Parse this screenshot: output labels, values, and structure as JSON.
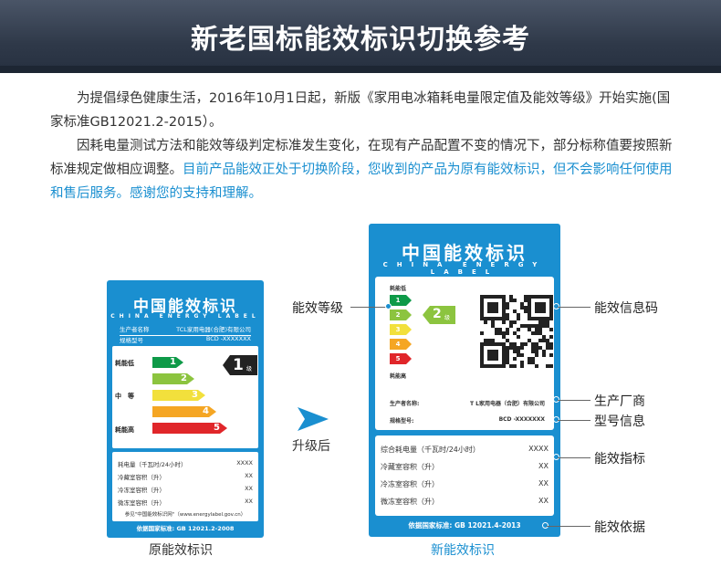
{
  "header": {
    "title": "新老国标能效标识切换参考"
  },
  "intro": {
    "para1": "为提倡绿色健康生活，2016年10月1日起，新版《家用电冰箱耗电量限定值及能效等级》开始实施(国家标准GB12021.2-2015）。",
    "para2_black": "因耗电量测试方法和能效等级判定标准发生变化，在现有产品配置不变的情况下，部分标称值要按照新标准规定做相应调整。",
    "para2_blue": "目前产品能效正处于切换阶段，您收到的产品为原有能效标识，但不会影响任何使用和售后服务。感谢您的支持和理解。"
  },
  "old_label": {
    "title_cn": "中国能效标识",
    "title_en": "CHINA ENERGY LABEL",
    "manufacturer_key": "生产者名称",
    "manufacturer_value": "TCL家用电器(合肥)有限公司",
    "model_key": "规格型号",
    "model_value": "BCD -XXXXXXX",
    "scale_low": "耗能低",
    "scale_mid": "中　等",
    "scale_high": "耗能高",
    "grades": [
      "1",
      "2",
      "3",
      "4",
      "5"
    ],
    "grade_colors": [
      "#0e9a48",
      "#8cc43f",
      "#f2e03c",
      "#f5a623",
      "#e0262a"
    ],
    "current_grade": "1",
    "current_grade_suffix": "级",
    "specs": [
      {
        "label": "耗电量（千瓦时/24小时）",
        "value": "XXXX"
      },
      {
        "label": "冷藏室容积（升）",
        "value": "XX"
      },
      {
        "label": "冷冻室容积（升）",
        "value": "XX"
      },
      {
        "label": "微冻室容积（升）",
        "value": "XX"
      }
    ],
    "reference": "参见\"中国能效标识网\"（www.energylabel.gov.cn）",
    "basis": "依据国家标准: GB 12021.2-2008",
    "caption": "原能效标识"
  },
  "upgrade_label": "升级后",
  "new_label": {
    "title_cn": "中国能效标识",
    "title_en": "CHINA ENERGY LABEL",
    "scale_low": "耗能低",
    "scale_high": "耗能高",
    "grades": [
      "1",
      "2",
      "3",
      "4",
      "5"
    ],
    "grade_colors": [
      "#0e9a48",
      "#8cc43f",
      "#f2e03c",
      "#f5a623",
      "#e0262a"
    ],
    "current_grade": "2",
    "current_grade_suffix": "级",
    "manufacturer_key": "生产者名称:",
    "manufacturer_value": "T L家用电器（合肥）有限公司",
    "model_key": "规格型号:",
    "model_value": "BCD -XXXXXXX",
    "specs": [
      {
        "label": "综合耗电量（千瓦时/24小时）",
        "value": "XXXX"
      },
      {
        "label": "冷藏室容积（升）",
        "value": "XX"
      },
      {
        "label": "冷冻室容积（升）",
        "value": "XX"
      },
      {
        "label": "微冻室容积（升）",
        "value": "XX"
      }
    ],
    "basis": "依据国家标准: GB 12021.4-2013",
    "caption": "新能效标识"
  },
  "callouts": {
    "grade": "能效等级",
    "qr": "能效信息码",
    "manufacturer": "生产厂商",
    "model": "型号信息",
    "indicator": "能效指标",
    "basis": "能效依据"
  },
  "accent_color": "#1a8fd0"
}
